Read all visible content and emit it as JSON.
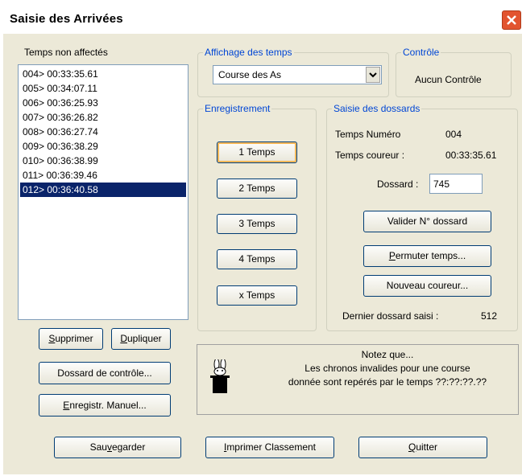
{
  "window": {
    "title": "Saisie des Arrivées"
  },
  "left_panel": {
    "label": "Temps non affectés",
    "items": [
      "004> 00:33:35.61",
      "005> 00:34:07.11",
      "006> 00:36:25.93",
      "007> 00:36:26.82",
      "008> 00:36:27.74",
      "009> 00:36:38.29",
      "010> 00:36:38.99",
      "011> 00:36:39.46",
      "012> 00:36:40.58"
    ],
    "selected_index": 8,
    "delete_label": "Supprimer",
    "delete_accel": "S",
    "delete_rest": "upprimer",
    "duplicate_accel": "D",
    "duplicate_rest": "upliquer",
    "control_bib_label": "Dossard de contrôle...",
    "manual_accel": "E",
    "manual_rest": "nregistr. Manuel..."
  },
  "affichage": {
    "title": "Affichage des temps",
    "selected": "Course des As"
  },
  "controle": {
    "title": "Contrôle",
    "value": "Aucun Contrôle"
  },
  "enregistrement": {
    "title": "Enregistrement",
    "buttons": [
      "1 Temps",
      "2 Temps",
      "3 Temps",
      "4 Temps",
      "x Temps"
    ]
  },
  "saisie": {
    "title": "Saisie des dossards",
    "temps_numero_label": "Temps Numéro",
    "temps_numero_value": "004",
    "temps_coureur_label": "Temps coureur :",
    "temps_coureur_value": "00:33:35.61",
    "dossard_label": "Dossard :",
    "dossard_value": "745",
    "valider_label": "Valider N° dossard",
    "permuter_accel": "P",
    "permuter_rest": "ermuter temps...",
    "nouveau_label": "Nouveau coureur...",
    "dernier_label": "Dernier dossard saisi :",
    "dernier_value": "512"
  },
  "note": {
    "line1": "Notez que...",
    "line2": "Les chronos invalides pour une course",
    "line3": "donnée sont repérés par le temps ??:??:??.??"
  },
  "footer": {
    "save_pre": "Sau",
    "save_accel": "v",
    "save_rest": "egarder",
    "print_accel": "I",
    "print_rest": "mprimer Classement",
    "quit_accel": "Q",
    "quit_rest": "uitter"
  },
  "icons": {
    "close": "close-icon",
    "dropdown": "chevron-down-icon",
    "note": "magic-hat-rabbit-icon"
  },
  "colors": {
    "selection": "#0a246a",
    "group_title": "#0046d5",
    "close_button": "#e2542f"
  }
}
